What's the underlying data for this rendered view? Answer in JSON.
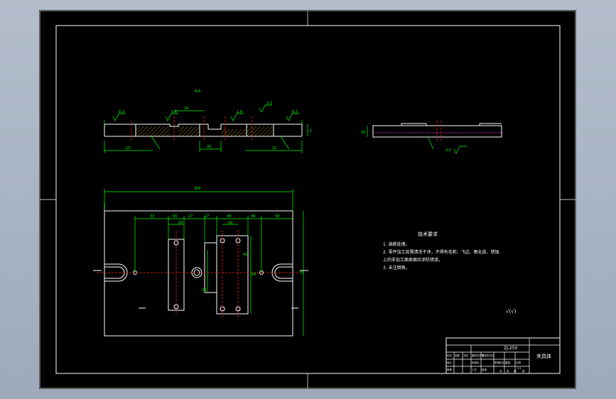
{
  "views": {
    "section_label": "A-A",
    "side_dim": "20"
  },
  "dims": {
    "overall_width": "300",
    "d33": "33",
    "d90": "90",
    "d27": "27",
    "d48": "48",
    "d36": "36",
    "d58": "58",
    "d19a": "19",
    "d19b": "19",
    "d38": "38",
    "d70": "70",
    "d42": "42",
    "d60": "60",
    "d25": "25",
    "d12": "12",
    "d20": "20",
    "d14": "14",
    "d3": "3",
    "roughness_a": "6.3",
    "roughness_b": "1.6",
    "roughness_c": "3.2"
  },
  "tech": {
    "title": "技术要求",
    "lines": [
      "1. 调质处理。",
      "2. 零件加工前需清洗干净，不得有毛刺、飞边、氧化皮、锈蚀",
      "   上的非加工面表面应涂防锈漆。",
      "3. 未注倒角。"
    ],
    "roughness_note": "√(√)"
  },
  "titleblock": {
    "part_code": "ZJ-250",
    "part_name": "夹具体",
    "row_labels": [
      "标记",
      "处数",
      "分区",
      "更改文件号",
      "签名",
      "年月日"
    ],
    "role_labels": [
      "设计",
      "审核",
      "工艺",
      "标准化",
      "批准"
    ],
    "stage_labels": [
      "阶段标记",
      "重量",
      "比例"
    ],
    "scale": "1:1",
    "sheet_labels": [
      "共",
      "张",
      "第",
      "张"
    ]
  },
  "colors": {
    "background": "#000000",
    "outline": "#ffffff",
    "dimension": "#00ff00",
    "centerline": "#ff2020",
    "hatch": "#ffd000"
  }
}
